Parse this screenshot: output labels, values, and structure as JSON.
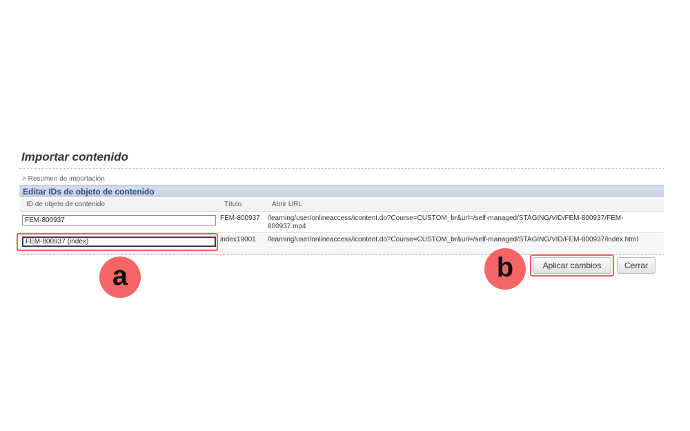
{
  "page": {
    "title": "Importar contenido"
  },
  "breadcrumb": "> Resumen de importación",
  "section": {
    "header": "Editar IDs de objeto de contenido"
  },
  "table": {
    "columns": [
      "ID de objeto de contenido",
      "Título",
      "Abrir URL"
    ],
    "rows": [
      {
        "id_value": "FEM-800937",
        "title": "FEM-800937",
        "url": "/learning/user/onlineaccess/icontent.do?Course=CUSTOM_br&url=/self-managed/STAGING/VID/FEM-800937/FEM-800937.mp4"
      },
      {
        "id_value": "FEM-800937 (index)",
        "title": "index19001",
        "url": "/learning/user/onlineaccess/icontent.do?Course=CUSTOM_br&url=/self-managed/STAGING/VID/FEM-800937/index.html"
      }
    ]
  },
  "buttons": {
    "apply": "Aplicar cambios",
    "close": "Cerrar"
  },
  "markers": {
    "a": "a",
    "b": "b"
  },
  "colors": {
    "highlight": "#e8635a",
    "marker": "#f56565",
    "header_text": "#2d4c7a"
  }
}
